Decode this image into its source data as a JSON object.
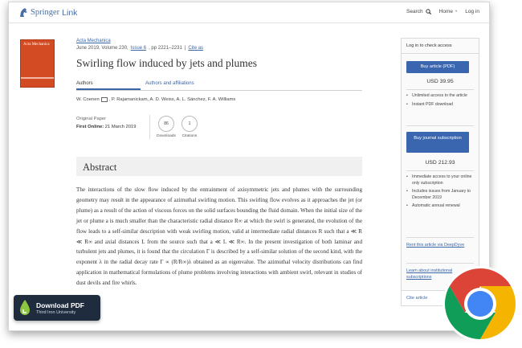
{
  "header": {
    "logo_name": "Springer",
    "logo_suffix": "Link",
    "nav": [
      "Search",
      "Home",
      "Log in"
    ],
    "nav_sep": "•"
  },
  "journal": {
    "cover_title": "Acta Mechanica",
    "name": "Acta Mechanica",
    "date_line": "June 2019, Volume 230,",
    "issue": "Issue 6",
    "pages": ", pp 2221–2231",
    "sep": "|",
    "cite_as": "Cite as"
  },
  "article": {
    "title": "Swirling flow induced by jets and plumes",
    "tabs": [
      "Authors",
      "Authors and affiliations"
    ],
    "authors_first": "W. Coenen",
    "authors_rest": ", P. Rajamanickam, A. D. Weiss, A. L. Sánchez, F. A. Williams",
    "paper_type": "Original Paper",
    "first_online_label": "First Online:",
    "first_online_date": "21 March 2019",
    "downloads_value": "86",
    "downloads_label": "Downloads",
    "citations_value": "1",
    "citations_label": "Citations"
  },
  "abstract": {
    "heading": "Abstract",
    "text": "The interactions of the slow flow induced by the entrainment of axisymmetric jets and plumes with the surrounding geometry may result in the appearance of azimuthal swirling motion. This swirling flow evolves as it approaches the jet (or plume) as a result of the action of viscous forces on the solid surfaces bounding the fluid domain. When the initial size of the jet or plume a is much smaller than the characteristic radial distance R∞ at which the swirl is generated, the evolution of the flow leads to a self-similar description with weak swirling motion, valid at intermediate radial distances R such that a ≪ R ≪ R∞ and axial distances L from the source such that a ≪ L ≪ R∞. In the present investigation of both laminar and turbulent jets and plumes, it is found that the circulation Γ is described by a self-similar solution of the second kind, with the exponent λ in the radial decay rate Γ ∝ (R/R∞)λ obtained as an eigenvalue. The azimuthal velocity distributions can find application in mathematical formulations of plume problems involving interactions with ambient swirl, relevant in studies of dust devils and fire whirls."
  },
  "sidebar": {
    "login": "Log in to check access",
    "buy_article": "Buy article (PDF)",
    "price_article": "USD 39.95",
    "article_features": [
      "Unlimited access to the article",
      "Instant PDF download"
    ],
    "buy_journal": "Buy journal subscription",
    "price_journal": "USD 212.93",
    "journal_features": [
      "Immediate access to your online only subscription",
      "Includes issues from January to December 2019",
      "Automatic annual renewal"
    ],
    "rent": "Rent this article via DeepDyve",
    "learn": "Learn about institutional subscriptions",
    "cite": "Cite article"
  },
  "download_badge": {
    "main": "Download PDF",
    "sub": "Third Iron University"
  },
  "colors": {
    "accent": "#3a66b0",
    "cover": "#d24b22",
    "badge": "#1e2c3e"
  }
}
